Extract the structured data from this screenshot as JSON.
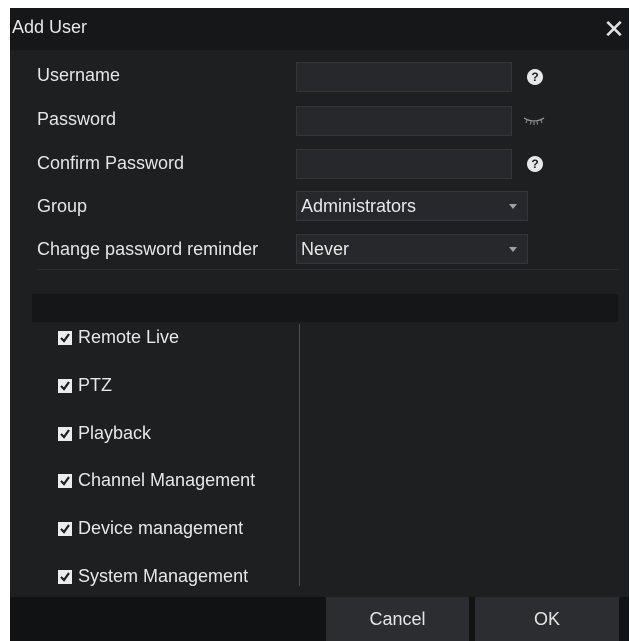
{
  "dialog": {
    "title": "Add User",
    "close_glyph": "✕"
  },
  "form": {
    "username_label": "Username",
    "username_value": "",
    "password_label": "Password",
    "password_value": "",
    "confirm_label": "Confirm Password",
    "confirm_value": "",
    "group_label": "Group",
    "group_value": "Administrators",
    "reminder_label": "Change password reminder",
    "reminder_value": "Never",
    "help_glyph": "?"
  },
  "permissions": [
    {
      "label": "Remote Live",
      "checked": true
    },
    {
      "label": "PTZ",
      "checked": true
    },
    {
      "label": "Playback",
      "checked": true
    },
    {
      "label": "Channel Management",
      "checked": true
    },
    {
      "label": "Device management",
      "checked": true
    },
    {
      "label": "System Management",
      "checked": true
    }
  ],
  "footer": {
    "cancel_label": "Cancel",
    "ok_label": "OK"
  },
  "icons": {
    "help": "question-circle-icon",
    "eye": "eye-closed-icon",
    "caret": "chevron-down-icon",
    "check": "check-icon"
  },
  "colors": {
    "dialog_bg": "#1e1f21",
    "titlebar_bg": "#161719",
    "input_bg": "#26282b",
    "button_bg": "#2b2d30"
  }
}
